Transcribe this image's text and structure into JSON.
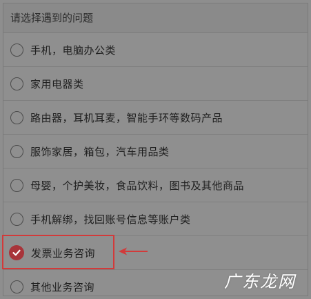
{
  "header": {
    "title": "请选择遇到的问题"
  },
  "options": [
    {
      "label": "手机，电脑办公类",
      "checked": false
    },
    {
      "label": "家用电器类",
      "checked": false
    },
    {
      "label": "路由器，耳机耳麦，智能手环等数码产品",
      "checked": false
    },
    {
      "label": "服饰家居，箱包，汽车用品类",
      "checked": false
    },
    {
      "label": "母婴，个护美妆，食品饮料，图书及其他商品",
      "checked": false
    },
    {
      "label": "手机解绑，找回账号信息等账户类",
      "checked": false
    },
    {
      "label": "发票业务咨询",
      "checked": true
    },
    {
      "label": "其他业务咨询",
      "checked": false
    }
  ],
  "icons": {
    "radio": "radio-icon",
    "checked": "check-icon",
    "arrow": "arrow-left-icon"
  },
  "colors": {
    "accent": "#a8343a",
    "highlight": "#d23a3a"
  },
  "watermark": "广东龙网"
}
